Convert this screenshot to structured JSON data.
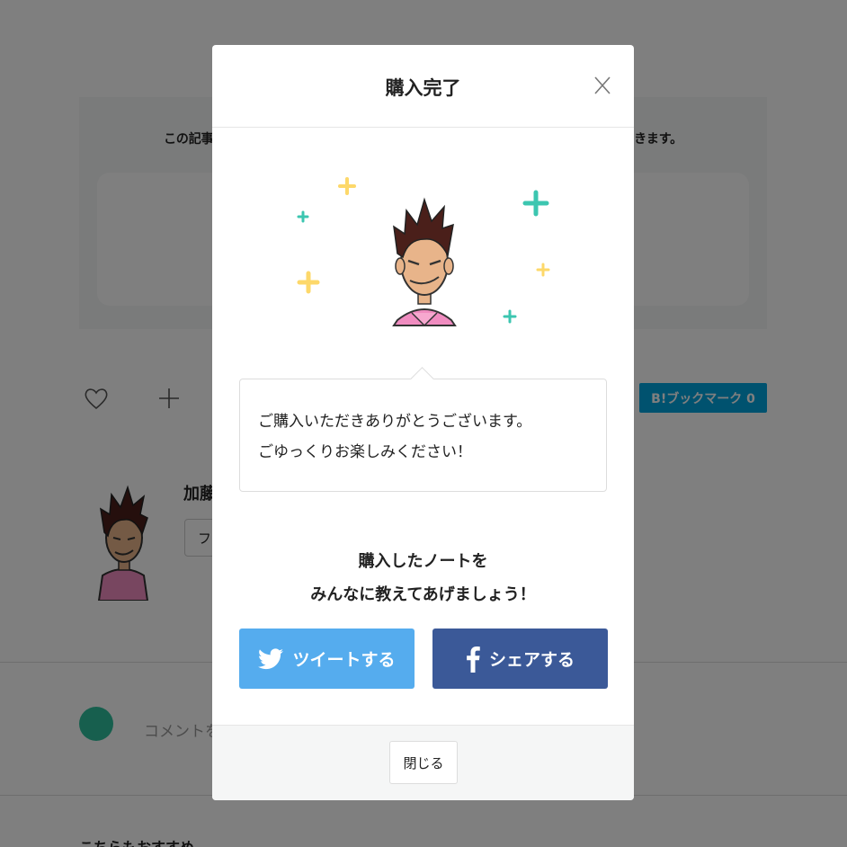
{
  "background": {
    "support_text": "この記事が気に入ったら、サポートをしてみませんか？気軽にクリエイターを支援できます。",
    "hatena_label": "B!ブックマーク 0",
    "author_name": "加藤",
    "follow_label": "フォロー",
    "comment_placeholder": "コメントを入力...",
    "recommend_title": "こちらもおすすめ"
  },
  "modal": {
    "title": "購入完了",
    "message_lines": [
      "ご購入いただきありがとうございます。",
      "ごゆっくりお楽しみください！"
    ],
    "share_prompt_lines": [
      "購入したノートを",
      "みんなに教えてあげましょう！"
    ],
    "tweet_label": "ツイートする",
    "facebook_label": "シェアする",
    "close_label": "閉じる"
  },
  "colors": {
    "overlay": "rgba(0,0,0,0.5)",
    "twitter": "#55acee",
    "facebook": "#3b5998",
    "hatena": "#00a4de",
    "sparkle_teal": "#3cc6b0",
    "sparkle_yellow": "#fdd86a"
  },
  "icons": [
    "close-icon",
    "twitter-bird-icon",
    "facebook-f-icon",
    "heart-icon",
    "plus-icon",
    "sparkle-icon"
  ]
}
